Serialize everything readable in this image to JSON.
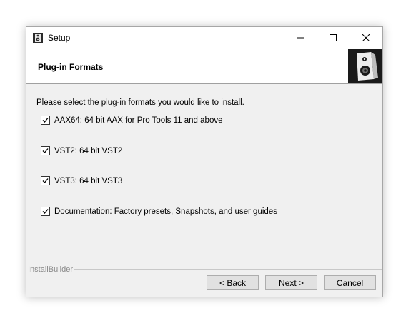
{
  "window": {
    "title": "Setup"
  },
  "header": {
    "title": "Plug-in Formats",
    "logo_icon": "speaker-icon"
  },
  "content": {
    "instructions": "Please select the plug-in formats you would like to install.",
    "options": [
      {
        "label": "AAX64: 64 bit AAX for Pro Tools 11 and above",
        "checked": true
      },
      {
        "label": "VST2: 64 bit VST2",
        "checked": true
      },
      {
        "label": "VST3: 64 bit VST3",
        "checked": true
      },
      {
        "label": "Documentation: Factory presets, Snapshots, and user guides",
        "checked": true
      }
    ]
  },
  "footer": {
    "brand": "InstallBuilder",
    "back_label": "< Back",
    "next_label": "Next >",
    "cancel_label": "Cancel"
  },
  "colors": {
    "window_bg": "#f0f0f0",
    "header_bg": "#ffffff",
    "logo_bg": "#1a1a1a",
    "button_bg": "#e1e1e1"
  }
}
